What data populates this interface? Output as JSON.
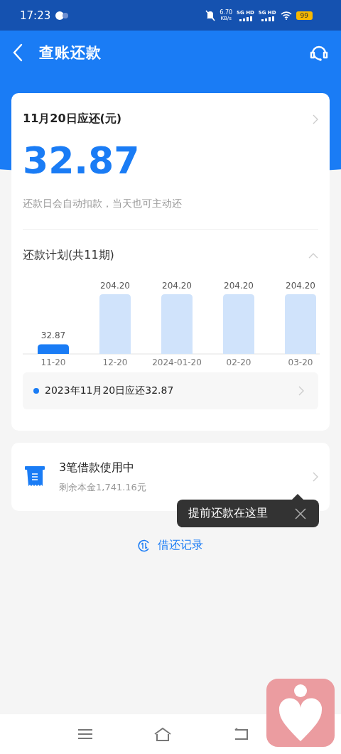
{
  "status_bar": {
    "time": "17:23",
    "speed": "6.70",
    "speed_unit": "KB/s",
    "networks": [
      "5G HD",
      "5G HD"
    ],
    "battery": "99"
  },
  "header": {
    "title": "查账还款"
  },
  "due_card": {
    "title": "11月20日应还(元)",
    "amount": "32.87",
    "note": "还款日会自动扣款，当天也可主动还"
  },
  "plan": {
    "title": "还款计划(共11期)",
    "expanded": true,
    "chart_data": {
      "type": "bar",
      "categories": [
        "11-20",
        "12-20",
        "2024-01-20",
        "02-20",
        "03-20"
      ],
      "series": [
        {
          "values": [
            32.87,
            204.2,
            204.2,
            204.2,
            204.2
          ],
          "value_labels": [
            "32.87",
            "204.20",
            "204.20",
            "204.20",
            "204.20"
          ]
        }
      ],
      "data_labels": true
    },
    "periods": [
      {
        "selected": true
      },
      {
        "selected": false
      },
      {
        "selected": false
      },
      {
        "selected": false
      },
      {
        "selected": false
      }
    ],
    "detail": "2023年11月20日应还32.87"
  },
  "loans_card": {
    "title": "3笔借款使用中",
    "subtitle": "剩余本金1,741.16元"
  },
  "tooltip": {
    "text": "提前还款在这里"
  },
  "records_link": {
    "label": "借还记录"
  }
}
